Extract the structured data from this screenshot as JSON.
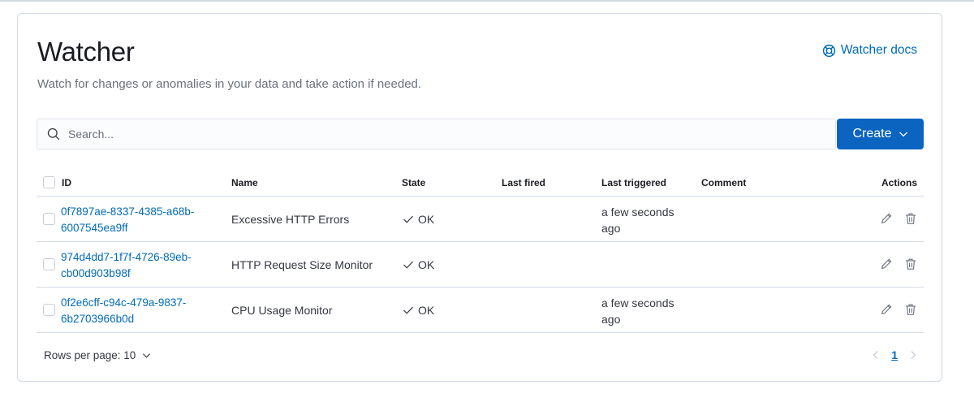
{
  "page": {
    "title": "Watcher",
    "subtitle": "Watch for changes or anomalies in your data and take action if needed.",
    "docs_link": "Watcher docs"
  },
  "search": {
    "placeholder": "Search..."
  },
  "create_button": {
    "label": "Create"
  },
  "table": {
    "columns": {
      "id": "ID",
      "name": "Name",
      "state": "State",
      "last_fired": "Last fired",
      "last_triggered": "Last triggered",
      "comment": "Comment",
      "actions": "Actions"
    },
    "rows": [
      {
        "id": "0f7897ae-8337-4385-a68b-6007545ea9ff",
        "name": "Excessive HTTP Errors",
        "state": "OK",
        "last_fired": "",
        "last_triggered": "a few seconds ago",
        "comment": ""
      },
      {
        "id": "974d4dd7-1f7f-4726-89eb-cb00d903b98f",
        "name": "HTTP Request Size Monitor",
        "state": "OK",
        "last_fired": "",
        "last_triggered": "",
        "comment": ""
      },
      {
        "id": "0f2e6cff-c94c-479a-9837-6b2703966b0d",
        "name": "CPU Usage Monitor",
        "state": "OK",
        "last_fired": "",
        "last_triggered": "a few seconds ago",
        "comment": ""
      }
    ]
  },
  "footer": {
    "rows_per_page": "Rows per page: 10",
    "current_page": "1"
  },
  "icons": {
    "docs": "help-circle-icon",
    "search": "search-icon",
    "create_menu": "chevron-down-icon",
    "state_ok": "check-icon",
    "edit": "pencil-icon",
    "delete": "trash-icon",
    "prev": "chevron-left-icon",
    "next": "chevron-right-icon"
  },
  "colors": {
    "primary": "#0b64c0",
    "link": "#006bb8",
    "border": "#d3dae6",
    "text": "#343741",
    "muted": "#69707d"
  }
}
